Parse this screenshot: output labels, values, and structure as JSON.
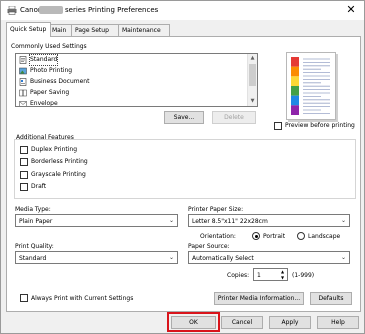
{
  "window": {
    "title_prefix": "Canon",
    "title_suffix": "series Printing Preferences",
    "close_glyph": "✕",
    "icon": "printer-icon"
  },
  "tabs": [
    {
      "label": "Quick Setup",
      "active": true
    },
    {
      "label": "Main"
    },
    {
      "label": "Page Setup"
    },
    {
      "label": "Maintenance"
    }
  ],
  "commonly_used": {
    "title": "Commonly Used Settings",
    "items": [
      {
        "label": "Standard",
        "icon": "standard-doc-icon",
        "selected": true
      },
      {
        "label": "Photo Printing",
        "icon": "photo-icon"
      },
      {
        "label": "Business Document",
        "icon": "business-doc-icon"
      },
      {
        "label": "Paper Saving",
        "icon": "paper-saving-icon"
      },
      {
        "label": "Envelope",
        "icon": "envelope-icon"
      }
    ],
    "save_label": "Save...",
    "delete_label": "Delete"
  },
  "preview": {
    "checkbox_label": "Preview before printing",
    "checked": false,
    "stripe_colors": [
      "#e53935",
      "#fb8c00",
      "#fdd835",
      "#43a047",
      "#1e88e5",
      "#8e24aa"
    ]
  },
  "additional_features": {
    "title": "Additional Features",
    "items": [
      {
        "label": "Duplex Printing",
        "checked": false
      },
      {
        "label": "Borderless Printing",
        "checked": false
      },
      {
        "label": "Grayscale Printing",
        "checked": false
      },
      {
        "label": "Draft",
        "checked": false
      }
    ]
  },
  "media_type": {
    "label": "Media Type:",
    "value": "Plain Paper"
  },
  "printer_paper_size": {
    "label": "Printer Paper Size:",
    "value": "Letter 8.5\"x11\" 22x28cm"
  },
  "orientation": {
    "label": "Orientation:",
    "portrait": "Portrait",
    "landscape": "Landscape",
    "selected": "Portrait"
  },
  "print_quality": {
    "label": "Print Quality:",
    "value": "Standard"
  },
  "paper_source": {
    "label": "Paper Source:",
    "value": "Automatically Select"
  },
  "copies": {
    "label": "Copies:",
    "value": "1",
    "range": "(1-999)"
  },
  "always_print": {
    "label": "Always Print with Current Settings",
    "checked": false
  },
  "printer_media_info_label": "Printer Media Information...",
  "defaults_label": "Defaults",
  "footer": {
    "ok": "OK",
    "cancel": "Cancel",
    "apply": "Apply",
    "help": "Help"
  },
  "highlight_color": "#d9141b"
}
